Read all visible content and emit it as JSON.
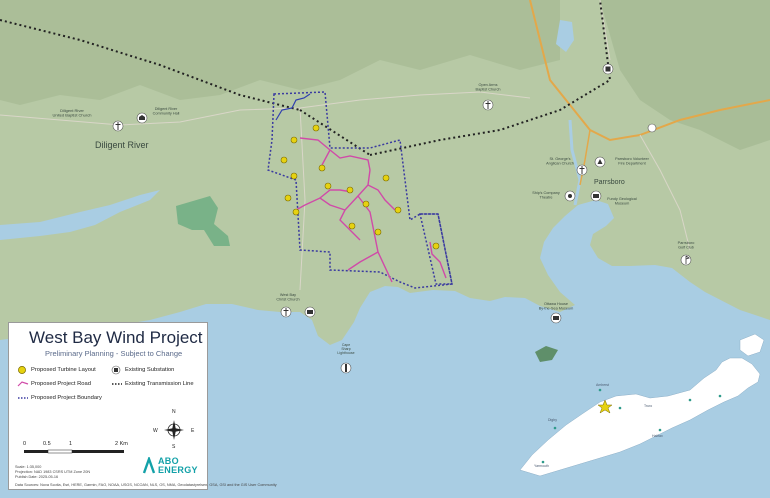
{
  "project": {
    "title": "West Bay Wind Project",
    "subtitle": "Preliminary Planning - Subject to Change"
  },
  "legend": {
    "turbine": "Proposed Turbine Layout",
    "road": "Proposed Project Road",
    "boundary": "Proposed Project Boundary",
    "substation": "Existing Substation",
    "transmission": "Existing Transmission Line"
  },
  "scale": {
    "ticks": [
      "0",
      "0.5",
      "1",
      "2 Km"
    ]
  },
  "compass": {
    "n": "N",
    "s": "S",
    "e": "E",
    "w": "W"
  },
  "meta": {
    "scale_text": "Scale: 1:35,000",
    "projection": "Projection: NAD 1983 CSRS UTM Zone 20N",
    "publish_date": "Publish Date: 2025-05-16",
    "sources": "Data Sources: Nova Scotia, Esri, HERE, Garmin, FAO, NOAA, USGS, NCOAN, NLS, OS, NMA, Geodatastyrelsen, GSA, GSI and the GIS User Community"
  },
  "brand": {
    "line1": "ABO",
    "line2": "ENERGY",
    "color": "#13a1a8"
  },
  "places": {
    "diligent_river": "Diligent River",
    "diligent_church": "Diligent River\nUnited Baptist Church",
    "diligent_hall": "Diligent River\nCommunity Hall",
    "open_arms": "Open Arms\nBaptist Church",
    "parrsboro": "Parrsboro",
    "st_georges": "St. George's\nAnglican Church",
    "ships_company": "Ship's Company\nTheatre",
    "fire_dept": "Parrsboro Volunteer\nFire Department",
    "geological": "Fundy Geological\nMuseum",
    "golf": "Parrsboro\nGolf Club",
    "west_bay_church": "West Bay\nChrist Church",
    "ottawa_house": "Ottawa House\nBy-the-Sea Museum",
    "cape": "Cape\nSharp\nLighthouse"
  },
  "inset_labels": {
    "amherst": "Amherst",
    "truro": "Truro",
    "digby": "Digby",
    "halifax": "Halifax",
    "yarmouth": "Yarmouth"
  },
  "colors": {
    "water": "#a9cde3",
    "land": "#b7c9a5",
    "road": "#d04aa8",
    "boundary": "#3a3aa0",
    "turbine": "#e6d210",
    "protected": "#6fae83",
    "highway": "#e3a84a"
  }
}
